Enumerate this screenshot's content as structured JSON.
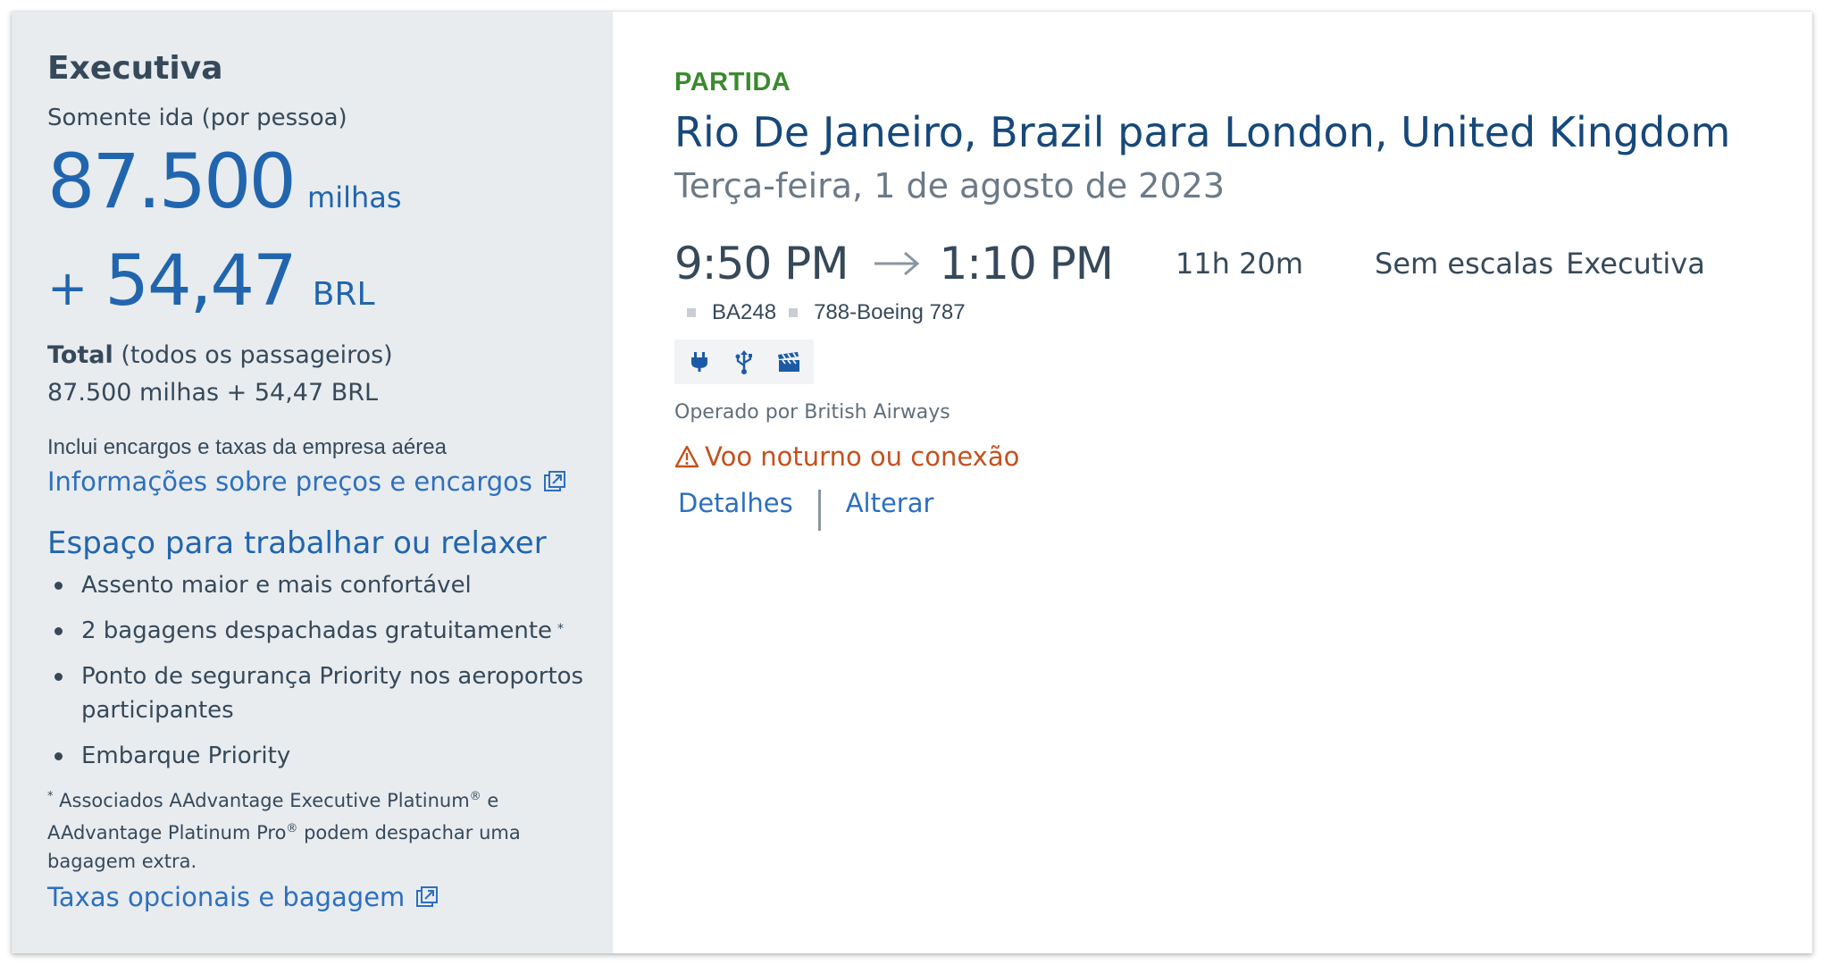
{
  "fare": {
    "cabin": "Executiva",
    "trip_type": "Somente ida (por pessoa)",
    "miles_amount": "87.500",
    "miles_unit": "milhas",
    "plus_sign": "+",
    "cash_amount": "54,47",
    "cash_unit": "BRL",
    "total_label_bold": "Total",
    "total_label_rest": " (todos os passageiros)",
    "total_value": "87.500 milhas + 54,47 BRL",
    "includes_text": "Inclui encargos e taxas da empresa aérea",
    "info_link": "Informações sobre preços e encargos",
    "benefits_title": "Espaço para trabalhar ou relaxer",
    "benefits": [
      "Assento maior e mais confortável",
      "2 bagagens despachadas gratuitamente",
      "Ponto de segurança Priority nos aeroportos participantes",
      "Embarque Priority"
    ],
    "benefit_mark": "*",
    "footnote_mark": "*",
    "footnote_text_1": " Associados AAdvantage Executive Platinum",
    "footnote_reg_1": "®",
    "footnote_text_2": " e AAdvantage Platinum Pro",
    "footnote_reg_2": "®",
    "footnote_text_3": " podem despachar uma bagagem extra.",
    "fees_link": "Taxas opcionais e bagagem"
  },
  "flight": {
    "direction": "PARTIDA",
    "route": "Rio De Janeiro, Brazil para London, United Kingdom",
    "date": "Terça-feira, 1 de agosto de 2023",
    "depart_time": "9:50 PM",
    "arrive_time": "1:10 PM",
    "duration": "11h 20m",
    "stops": "Sem escalas",
    "cabin": "Executiva",
    "flight_number": "BA248",
    "aircraft": "788-Boeing 787",
    "amenities": [
      "power-outlet-icon",
      "usb-icon",
      "entertainment-icon"
    ],
    "operator": "Operado por British Airways",
    "warning": "Voo noturno ou conexão",
    "details_link": "Detalhes",
    "change_link": "Alterar"
  },
  "colors": {
    "accent_blue": "#2165ae",
    "link_blue": "#2d6fbf",
    "route_navy": "#17487a",
    "direction_green": "#3a8a2e",
    "warning_orange": "#c4511f",
    "panel_grey": "#e8ecef"
  }
}
